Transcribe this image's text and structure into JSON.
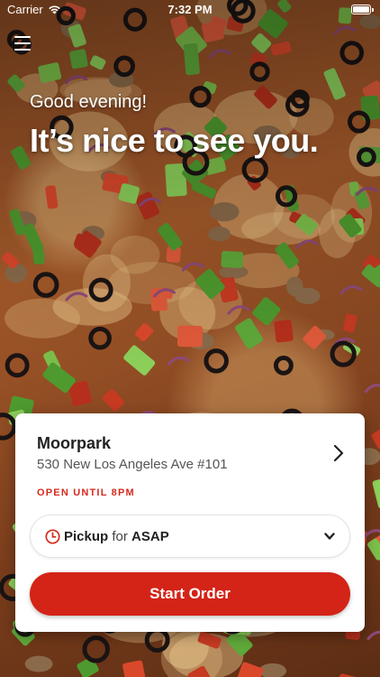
{
  "status_bar": {
    "carrier": "Carrier",
    "time": "7:32 PM"
  },
  "header": {
    "menu_icon": "hamburger-menu-icon",
    "greeting": "Good evening!",
    "headline": "It’s nice to see you."
  },
  "store_card": {
    "name": "Moorpark",
    "address": "530 New Los Angeles Ave #101",
    "open_status": "OPEN UNTIL 8PM",
    "pickup": {
      "mode": "Pickup",
      "connector": "for",
      "time": "ASAP"
    },
    "start_order_label": "Start Order"
  },
  "colors": {
    "accent": "#d32417",
    "status_text": "#d42b1e"
  }
}
